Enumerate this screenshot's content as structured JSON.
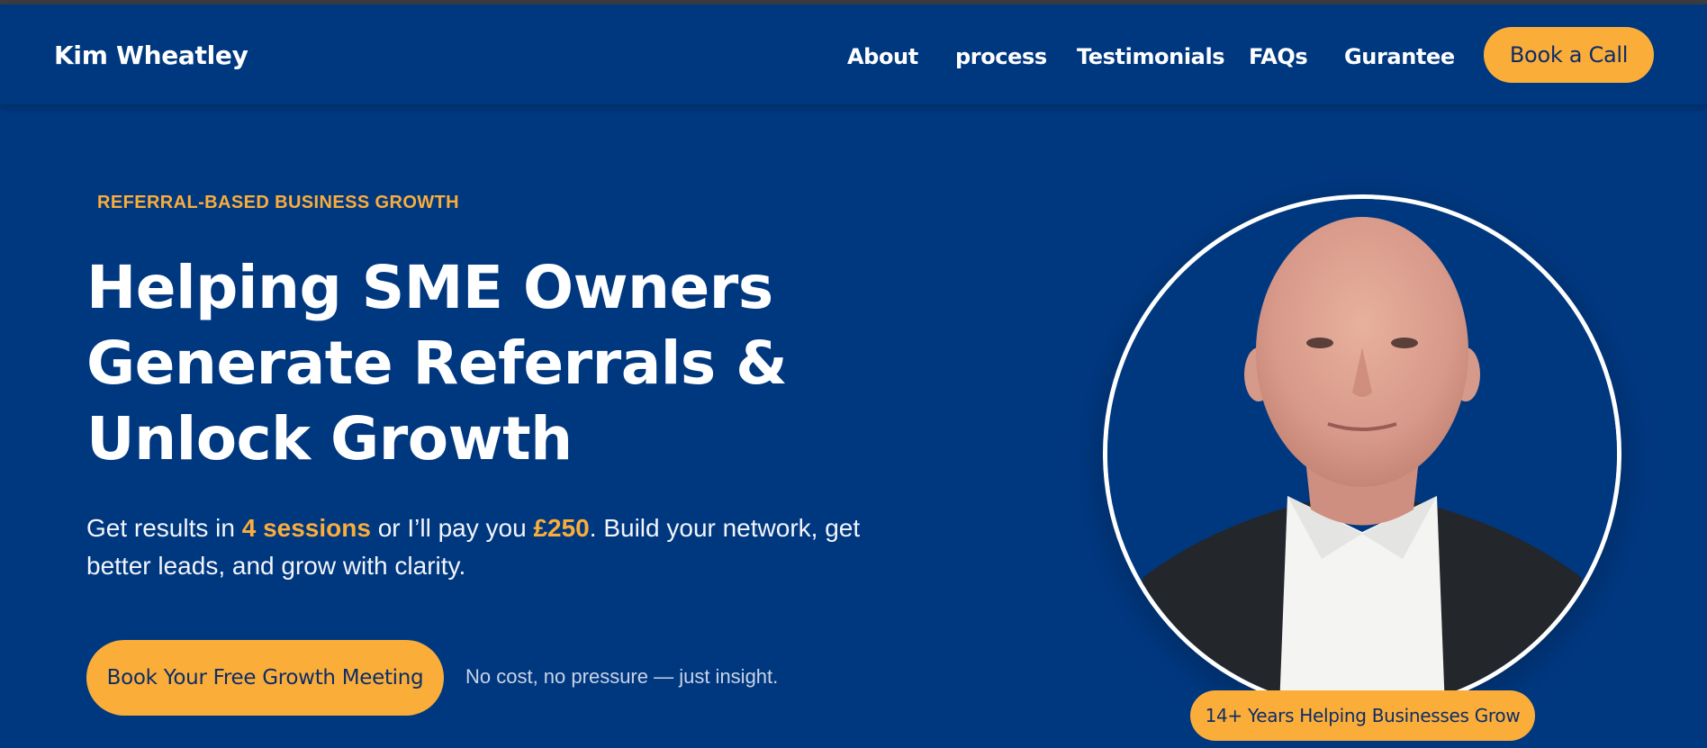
{
  "header": {
    "brand": "Kim Wheatley",
    "nav": {
      "about": "About",
      "process": "process",
      "testimonials": "Testimonials",
      "faqs": "FAQs",
      "gurantee": "Gurantee"
    },
    "book_call": "Book a Call"
  },
  "hero": {
    "eyebrow": "REFERRAL-BASED BUSINESS GROWTH",
    "headline": [
      "Helping SME Owners",
      "Generate Referrals &",
      "Unlock Growth"
    ],
    "subtext": {
      "part1": "Get results in ",
      "highlight1": "4 sessions",
      "part2": " or I’ll pay you ",
      "highlight2": "£250",
      "part3": ". Build your network, get better leads, and grow with clarity."
    },
    "cta_label": "Book Your Free Growth Meeting",
    "cta_note": "No cost, no pressure — just insight.",
    "badge": "14+ Years Helping Businesses Grow"
  },
  "colors": {
    "background": "#003880",
    "accent": "#fbad3a",
    "accent_text": "#0d2d66"
  }
}
